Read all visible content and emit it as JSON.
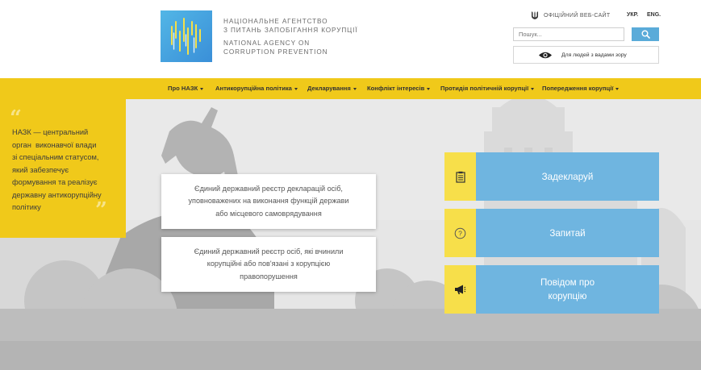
{
  "header": {
    "agency_ua_lines": [
      "НАЦІОНАЛЬНЕ АГЕНТСТВО",
      "З ПИТАНЬ ЗАПОБІГАННЯ КОРУПЦІЇ"
    ],
    "agency_en_lines": [
      "NATIONAL AGENCY ON",
      "CORRUPTION PREVENTION"
    ],
    "official_site": "ОФІЦІЙНИЙ ВЕБ-САЙТ",
    "lang_ua": "УКР.",
    "lang_en": "ENG.",
    "search_placeholder": "Пошук...",
    "vision_label": "Для людей з вадами зору"
  },
  "nav": {
    "items": [
      {
        "label": "Про НАЗК"
      },
      {
        "label": "Антикорупційна політика"
      },
      {
        "label": "Декларування"
      },
      {
        "label": "Конфлікт інтересів"
      },
      {
        "label": "Протидія політичній корупції"
      },
      {
        "label": "Попередження корупції"
      }
    ]
  },
  "hero": {
    "mission_lines": [
      "НАЗК — центральний",
      "орган  виконавчої влади",
      "зі спеціальним статусом,",
      "який забезпечує",
      "формування та реалізує",
      "державну антикорупційну",
      "політику"
    ],
    "registries": [
      {
        "lines": [
          "Єдиний державний реєстр декларацій осіб,",
          "уповноважених на виконання функцій держави",
          "або місцевого самоврядування"
        ]
      },
      {
        "lines": [
          "Єдиний державний реєстр осіб, які вчинили",
          "корупційні або пов'язані з корупцією",
          "правопорушення"
        ]
      }
    ],
    "actions": [
      {
        "lines": [
          "Задекларуй"
        ],
        "icon": "document-icon"
      },
      {
        "lines": [
          "Запитай"
        ],
        "icon": "question-icon"
      },
      {
        "lines": [
          "Повідом про",
          "корупцію"
        ],
        "icon": "megaphone-icon"
      }
    ]
  },
  "colors": {
    "accent_yellow": "#f0c91a",
    "icon_yellow": "#f7df4a",
    "action_blue": "#6fb5e0",
    "search_blue": "#5aabd9"
  }
}
